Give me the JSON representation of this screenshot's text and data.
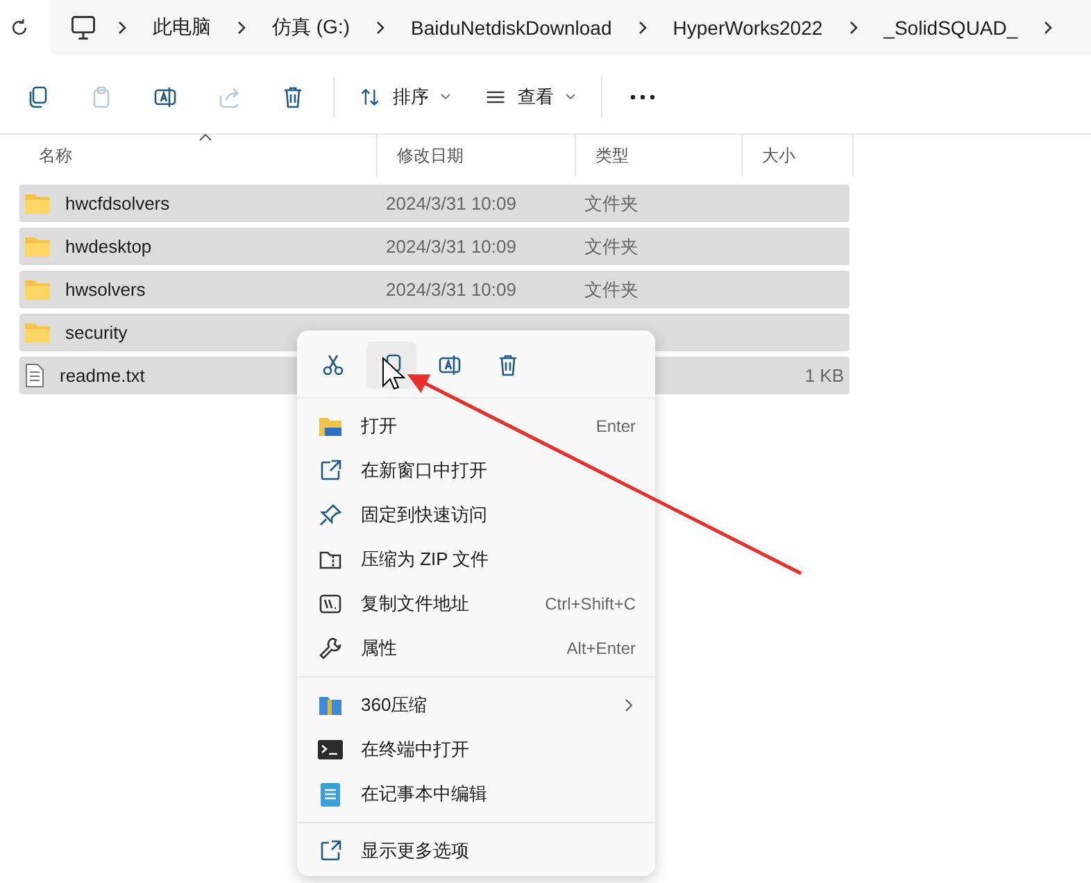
{
  "address_bar": {
    "path": [
      "此电脑",
      "仿真 (G:)",
      "BaiduNetdiskDownload",
      "HyperWorks2022",
      "_SolidSQUAD_"
    ]
  },
  "toolbar": {
    "icon_buttons": [
      {
        "kind": "copy",
        "disabled": false
      },
      {
        "kind": "paste",
        "disabled": true
      },
      {
        "kind": "rename",
        "disabled": false
      },
      {
        "kind": "share",
        "disabled": true
      },
      {
        "kind": "delete",
        "disabled": false
      }
    ],
    "menus": [
      {
        "kind": "sort",
        "label": "排序"
      },
      {
        "kind": "view",
        "label": "查看"
      }
    ]
  },
  "table": {
    "columns": [
      "名称",
      "修改日期",
      "类型",
      "大小"
    ],
    "rows": [
      {
        "kind": "folder",
        "name": "hwcfdsolvers",
        "date": "2024/3/31 10:09",
        "type": "文件夹",
        "selected": true
      },
      {
        "kind": "folder",
        "name": "hwdesktop",
        "date": "2024/3/31 10:09",
        "type": "文件夹",
        "selected": true
      },
      {
        "kind": "folder",
        "name": "hwsolvers",
        "date": "2024/3/31 10:09",
        "type": "文件夹",
        "selected": true
      },
      {
        "kind": "folder",
        "name": "security",
        "selected": true
      },
      {
        "kind": "file",
        "name": "readme.txt",
        "size": "1 KB",
        "selected": true
      }
    ]
  },
  "context_menu": {
    "quick_actions": [
      {
        "kind": "cut",
        "hovered": false
      },
      {
        "kind": "copy",
        "hovered": true
      },
      {
        "kind": "rename",
        "hovered": false
      },
      {
        "kind": "delete",
        "hovered": false
      }
    ],
    "sections": [
      [
        {
          "kind": "open",
          "label": "打开",
          "shortcut": "Enter"
        },
        {
          "kind": "new-window",
          "label": "在新窗口中打开"
        },
        {
          "kind": "pin",
          "label": "固定到快速访问"
        },
        {
          "kind": "zip",
          "label": "压缩为 ZIP 文件"
        },
        {
          "kind": "path",
          "label": "复制文件地址",
          "shortcut": "Ctrl+Shift+C"
        },
        {
          "kind": "properties",
          "label": "属性",
          "shortcut": "Alt+Enter"
        }
      ],
      [
        {
          "kind": "archive",
          "label": "360压缩",
          "submenu": true
        },
        {
          "kind": "terminal",
          "label": "在终端中打开"
        },
        {
          "kind": "notepad",
          "label": "在记事本中编辑"
        }
      ],
      [
        {
          "kind": "more",
          "label": "显示更多选项"
        }
      ]
    ]
  }
}
